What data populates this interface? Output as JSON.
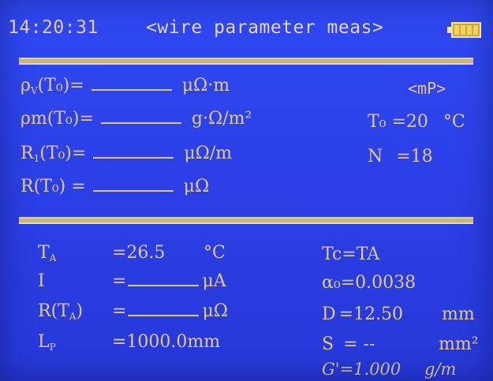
{
  "header": {
    "time": "14:20:31",
    "title": "<wire parameter meas>",
    "battery_icon": "battery-icon"
  },
  "top_section": {
    "rows": [
      {
        "symbol": "ρ",
        "subscript": "V",
        "arg": "(T₀)=",
        "unit": "μΩ·m"
      },
      {
        "symbol": "ρm",
        "subscript": "",
        "arg": "(T₀)=",
        "unit": "g·Ω/m²"
      },
      {
        "symbol": "R",
        "subscript": "1",
        "arg": "(T₀)=",
        "unit": "μΩ/m"
      },
      {
        "symbol": "R",
        "subscript": "",
        "arg": "(T₀) =",
        "unit": "μΩ"
      }
    ],
    "mode": "<mP>",
    "t0_label": "T₀ =",
    "t0_value": "20",
    "t0_unit": "°C",
    "n_label": "N",
    "n_value": "=18"
  },
  "bottom_section": {
    "ta": {
      "label": "T",
      "sub": "A",
      "value": "=26.5",
      "unit": "°C"
    },
    "i": {
      "label": "I",
      "value": "=",
      "unit": "μA"
    },
    "rta": {
      "label": "R(T",
      "sub": "A",
      "tail": ")",
      "value": "=",
      "unit": "μΩ"
    },
    "lp": {
      "label": "L",
      "sub": "P",
      "value": "=1000.0mm"
    },
    "tc": "Tc=TA",
    "a0": "α₀=0.0038",
    "d": {
      "label": "D",
      "value": "=12.50",
      "unit": "mm"
    },
    "s": {
      "label": "S",
      "value": "= --",
      "unit": "mm²"
    },
    "g": {
      "label": "G'",
      "value": "=1.000",
      "unit": "g/m"
    }
  },
  "colors": {
    "background": "#2b40e7",
    "text": "#e3c98a"
  }
}
